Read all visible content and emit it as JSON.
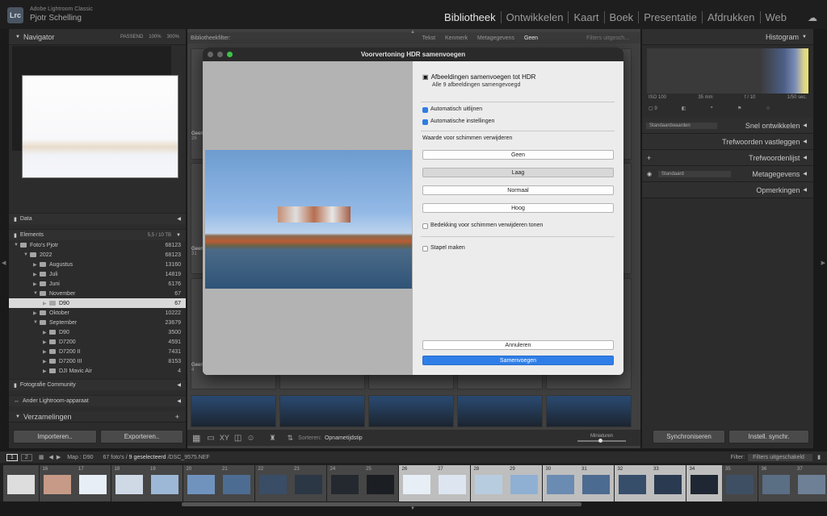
{
  "app": {
    "logo": "Lrc",
    "product": "Adobe Lightroom Classic",
    "user": "Pjotr Schelling"
  },
  "modules": [
    "Bibliotheek",
    "Ontwikkelen",
    "Kaart",
    "Boek",
    "Presentatie",
    "Afdrukken",
    "Web"
  ],
  "navigator": {
    "title": "Navigator",
    "zoom": [
      "PASSEND",
      "100%",
      "300%"
    ]
  },
  "left_sections": {
    "data": "Data",
    "elements": "Elements",
    "elements_meta": "5,5 / 10 TB",
    "fotografie": "Fotografie Community",
    "ander": "Ander Lightroom-apparaat",
    "verzamelingen": "Verzamelingen"
  },
  "folders": [
    {
      "name": "Foto's Pjotr",
      "count": "68123",
      "indent": 0
    },
    {
      "name": "2022",
      "count": "68123",
      "indent": 1
    },
    {
      "name": "Augustus",
      "count": "13160",
      "indent": 2
    },
    {
      "name": "Juli",
      "count": "14819",
      "indent": 2
    },
    {
      "name": "Juni",
      "count": "6176",
      "indent": 2
    },
    {
      "name": "November",
      "count": "67",
      "indent": 2
    },
    {
      "name": "D90",
      "count": "67",
      "indent": 3,
      "selected": true
    },
    {
      "name": "Oktober",
      "count": "10222",
      "indent": 2
    },
    {
      "name": "September",
      "count": "23679",
      "indent": 2
    },
    {
      "name": "D90",
      "count": "3500",
      "indent": 3
    },
    {
      "name": "D7200",
      "count": "4591",
      "indent": 3
    },
    {
      "name": "D7200 II",
      "count": "7431",
      "indent": 3
    },
    {
      "name": "D7200 III",
      "count": "8153",
      "indent": 3
    },
    {
      "name": "DJI Mavic Air",
      "count": "4",
      "indent": 3
    }
  ],
  "buttons": {
    "import": "Importeren..",
    "export": "Exporteren..",
    "sync": "Synchroniseren",
    "instell": "Instell. synchr."
  },
  "filterbar": {
    "label": "Bibliotheekfilter:",
    "tabs": [
      "Tekst",
      "Kenmerk",
      "Metagegevens",
      "Geen"
    ],
    "right": "Filters uitgesch..."
  },
  "grid_labels": [
    "Geen",
    "Geen",
    "Geen"
  ],
  "grid_numbers": [
    "26",
    "31",
    "4"
  ],
  "toolbar": {
    "sort_label": "Sorteren:",
    "sort_value": "Opnametijdstip",
    "miniaturen": "Miniaturen"
  },
  "right": {
    "histogram": "Histogram",
    "iso": "ISO 100",
    "focal": "35 mm",
    "aperture": "f / 10",
    "shutter": "1/50 sec.",
    "count": "9",
    "snel": "Snel ontwikkelen",
    "preset": "Standaardwaarden",
    "trefvastleggen": "Trefwoorden vastleggen",
    "treflijst": "Trefwoordenlijst",
    "metagegevens": "Metagegevens",
    "meta_preset": "Standaard",
    "opmerkingen": "Opmerkingen"
  },
  "dialog": {
    "title": "Voorvertoning HDR samenvoegen",
    "heading": "Afbeeldingen samenvoegen tot HDR",
    "sub": "Alle 9 afbeeldingen samengevoegd",
    "auto_align": "Automatisch uitlijnen",
    "auto_settings": "Automatische instellingen",
    "deghost_label": "Waarde voor schimmen verwijderen",
    "deghost_options": [
      "Geen",
      "Laag",
      "Normaal",
      "Hoog"
    ],
    "deghost_selected": "Laag",
    "overlay": "Bedekking voor schimmen verwijderen tonen",
    "stack": "Stapel maken",
    "cancel": "Annuleren",
    "merge": "Samenvoegen"
  },
  "filmstrip": {
    "pages": [
      "1",
      "2"
    ],
    "map": "Map : D90",
    "info": "67 foto's /",
    "selected": "9 geselecteerd",
    "file": "/DSC_9575.NEF",
    "filter_label": "Filter:",
    "filter_value": "Filters uitgeschakeld",
    "numbers": [
      "",
      "16",
      "17",
      "18",
      "19",
      "20",
      "21",
      "22",
      "23",
      "24",
      "25",
      "26",
      "27",
      "28",
      "29",
      "30",
      "31",
      "32",
      "33",
      "34",
      "35",
      "36",
      "37"
    ]
  }
}
